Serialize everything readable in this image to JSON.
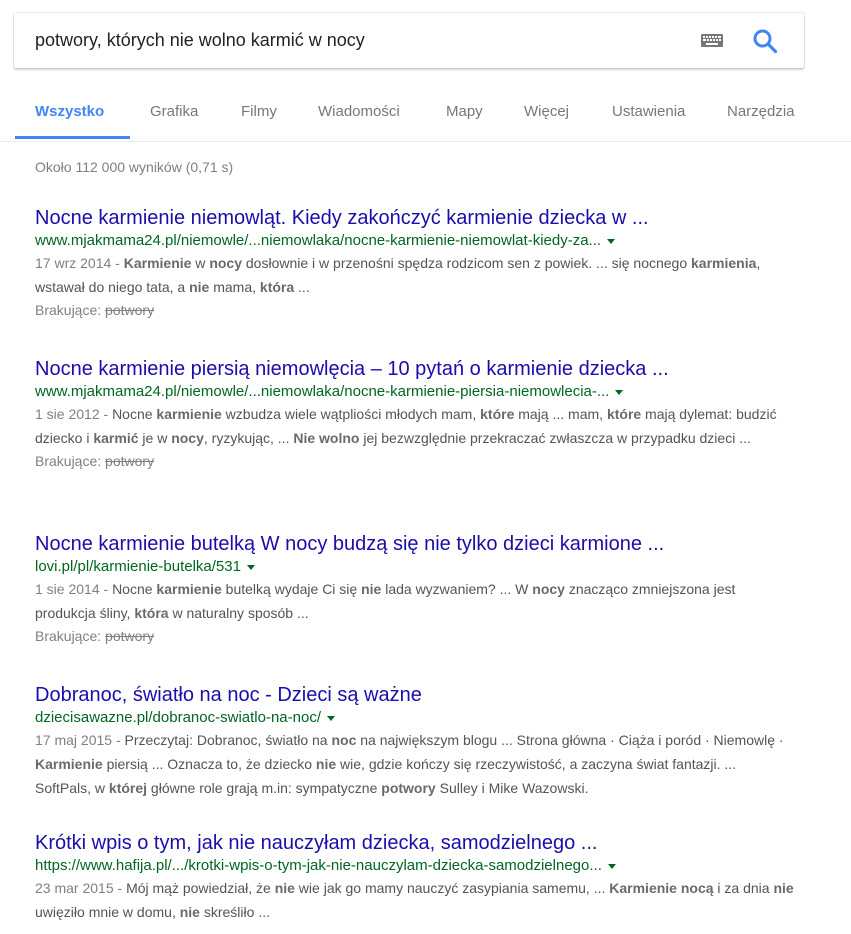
{
  "search": {
    "query": "potwory, których nie wolno karmić w nocy"
  },
  "tabs": [
    {
      "label": "Wszystko",
      "active": true
    },
    {
      "label": "Grafika"
    },
    {
      "label": "Filmy"
    },
    {
      "label": "Wiadomości"
    },
    {
      "label": "Mapy"
    },
    {
      "label": "Więcej"
    },
    {
      "label": "Ustawienia"
    },
    {
      "label": "Narzędzia"
    }
  ],
  "stats": "Około 112 000 wyników (0,71 s)",
  "results": [
    {
      "title": "Nocne karmienie niemowląt. Kiedy zakończyć karmienie dziecka w ...",
      "url": "www.mjakmama24.pl/niemowle/...niemowlaka/nocne-karmienie-niemowlat-kiedy-za...",
      "date": "17 wrz 2014 - ",
      "snippet": [
        {
          "t": "",
          "b": "Karmienie"
        },
        {
          "t": " w ",
          "b": "nocy"
        },
        {
          "t": " dosłownie i w przenośni spędza rodzicom sen z powiek. ... się nocnego ",
          "b": "karmienia"
        },
        {
          "t": ", wstawał do niego tata, a ",
          "b": "nie"
        },
        {
          "t": " mama, ",
          "b": "która"
        },
        {
          "t": " ...",
          "b": ""
        }
      ],
      "missing_label": "Brakujące:",
      "missing_word": "potwory"
    },
    {
      "title": "Nocne karmienie piersią niemowlęcia – 10 pytań o karmienie dziecka ...",
      "url": "www.mjakmama24.pl/niemowle/...niemowlaka/nocne-karmienie-piersia-niemowlecia-...",
      "date": "1 sie 2012 - ",
      "snippet": [
        {
          "t": "Nocne ",
          "b": "karmienie"
        },
        {
          "t": " wzbudza wiele wątpliości młodych mam, ",
          "b": "które"
        },
        {
          "t": " mają ... mam, ",
          "b": "które"
        },
        {
          "t": " mają dylemat: budzić dziecko i ",
          "b": "karmić"
        },
        {
          "t": " je w ",
          "b": "nocy"
        },
        {
          "t": ", ryzykując, ... ",
          "b": "Nie wolno"
        },
        {
          "t": " jej bezwzględnie przekraczać zwłaszcza w przypadku dzieci ...",
          "b": ""
        }
      ],
      "missing_label": "Brakujące:",
      "missing_word": "potwory"
    },
    {
      "title": "Nocne karmienie butelką W nocy budzą się nie tylko dzieci karmione ...",
      "url": "lovi.pl/pl/karmienie-butelka/531",
      "date": "1 sie 2014 - ",
      "snippet": [
        {
          "t": "Nocne ",
          "b": "karmienie"
        },
        {
          "t": " butelką wydaje Ci się ",
          "b": "nie"
        },
        {
          "t": " lada wyzwaniem? ... W ",
          "b": "nocy"
        },
        {
          "t": " znacząco zmniejszona jest produkcja śliny, ",
          "b": "która"
        },
        {
          "t": " w naturalny sposób ...",
          "b": ""
        }
      ],
      "missing_label": "Brakujące:",
      "missing_word": "potwory"
    },
    {
      "title": "Dobranoc, światło na noc - Dzieci są ważne",
      "url": "dziecisawazne.pl/dobranoc-swiatlo-na-noc/",
      "date": "17 maj 2015 - ",
      "snippet": [
        {
          "t": "Przeczytaj: Dobranoc, światło na ",
          "b": "noc"
        },
        {
          "t": " na największym blogu ... Strona główna · Ciąża i poród · Niemowlę · ",
          "b": "Karmienie"
        },
        {
          "t": " piersią ... Oznacza to, że dziecko ",
          "b": "nie"
        },
        {
          "t": " wie, gdzie kończy się rzeczywistość, a zaczyna świat fantazji. ... SoftPals, w ",
          "b": "której"
        },
        {
          "t": " główne role grają m.in: sympatyczne ",
          "b": "potwory"
        },
        {
          "t": " Sulley i Mike Wazowski.",
          "b": ""
        }
      ],
      "missing_label": "",
      "missing_word": ""
    },
    {
      "title": "Krótki wpis o tym, jak nie nauczyłam dziecka, samodzielnego ...",
      "url": "https://www.hafija.pl/.../krotki-wpis-o-tym-jak-nie-nauczylam-dziecka-samodzielnego...",
      "date": "23 mar 2015 - ",
      "snippet": [
        {
          "t": "Mój mąż powiedział, że ",
          "b": "nie"
        },
        {
          "t": " wie jak go mamy nauczyć zasypiania samemu, ... ",
          "b": "Karmienie nocą"
        },
        {
          "t": " i za dnia ",
          "b": "nie"
        },
        {
          "t": " uwięziło mnie w domu, ",
          "b": "nie"
        },
        {
          "t": " skreśliło ...",
          "b": ""
        }
      ],
      "missing_label": "",
      "missing_word": ""
    }
  ],
  "colors": {
    "link": "#1a0dab",
    "url": "#006621",
    "accent": "#4285f4",
    "snippet": "#545454",
    "muted": "#808080"
  },
  "icons": [
    "keyboard-icon",
    "search-icon",
    "dropdown-caret-icon"
  ]
}
